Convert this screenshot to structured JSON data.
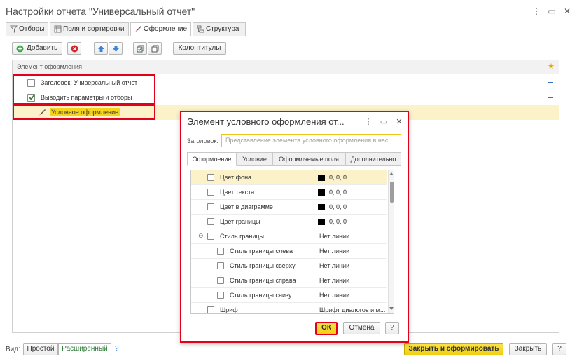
{
  "window": {
    "title": "Настройки отчета \"Универсальный отчет\"",
    "controls": {
      "more": "⋮",
      "restore": "▭",
      "close": "✕"
    }
  },
  "tabs": [
    {
      "label": "Отборы",
      "icon": "filter-icon"
    },
    {
      "label": "Поля и сортировки",
      "icon": "fields-icon"
    },
    {
      "label": "Оформление",
      "icon": "brush-icon",
      "active": true
    },
    {
      "label": "Структура",
      "icon": "structure-icon"
    }
  ],
  "toolbar": {
    "add_label": "Добавить",
    "delete_icon": "delete-icon",
    "move_up_icon": "arrow-up-icon",
    "move_down_icon": "arrow-down-icon",
    "check_all_icon": "check-all-icon",
    "copy_icon": "copy-icon",
    "headers_label": "Колонтитулы"
  },
  "grid": {
    "column_header": "Элемент оформления",
    "star": "★",
    "rows": [
      {
        "label": "Заголовок: Универсальный отчет",
        "checked": false
      },
      {
        "label": "Выводить параметры и отборы",
        "checked": true
      },
      {
        "label": "Условное оформление",
        "selected": true
      }
    ]
  },
  "footer": {
    "view_label": "Вид:",
    "simple_label": "Простой",
    "extended_label": "Расширенный",
    "help_label": "?",
    "close_generate_label": "Закрыть и сформировать",
    "close_label": "Закрыть",
    "question_label": "?"
  },
  "dialog": {
    "title": "Элемент условного оформления от...",
    "controls": {
      "more": "⋮",
      "restore": "▭",
      "close": "✕"
    },
    "header_label": "Заголовок:",
    "header_placeholder": "Представление элемента условного оформления в нас...",
    "tabs": [
      "Оформление",
      "Условие",
      "Оформляемые поля",
      "Дополнительно"
    ],
    "properties": [
      {
        "name": "Цвет фона",
        "value": "0, 0, 0",
        "swatch": "#000000",
        "indent": 0,
        "selected": true
      },
      {
        "name": "Цвет текста",
        "value": "0, 0, 0",
        "swatch": "#000000",
        "indent": 0
      },
      {
        "name": "Цвет в диаграмме",
        "value": "0, 0, 0",
        "swatch": "#000000",
        "indent": 0
      },
      {
        "name": "Цвет границы",
        "value": "0, 0, 0",
        "swatch": "#000000",
        "indent": 0
      },
      {
        "name": "Стиль границы",
        "value": "Нет линии",
        "indent": 0,
        "expander": "⊖"
      },
      {
        "name": "Стиль границы слева",
        "value": "Нет линии",
        "indent": 1
      },
      {
        "name": "Стиль границы сверху",
        "value": "Нет линии",
        "indent": 1
      },
      {
        "name": "Стиль границы справа",
        "value": "Нет линии",
        "indent": 1
      },
      {
        "name": "Стиль границы снизу",
        "value": "Нет линии",
        "indent": 1
      },
      {
        "name": "Шрифт",
        "value": "Шрифт диалогов и м...",
        "indent": 0
      }
    ],
    "ok_label": "ОК",
    "cancel_label": "Отмена",
    "help_label": "?"
  },
  "colors": {
    "accent_yellow": "#f5d21b",
    "selection": "#fbf2ca",
    "highlight_red": "#e3001b",
    "link_green": "#2c7a35",
    "dash_blue": "#3b73c4"
  }
}
